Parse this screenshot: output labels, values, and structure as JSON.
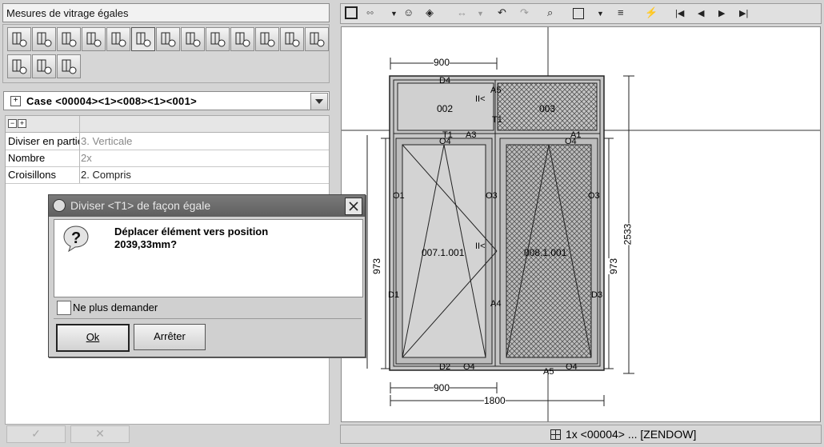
{
  "panel": {
    "title": "Mesures de vitrage égales",
    "combo_text": "Case <00004><1><008><1><001>",
    "props": [
      {
        "key": "Diviser en parties",
        "value": "3. Verticale",
        "dark": false
      },
      {
        "key": "Nombre",
        "value": "2x",
        "dark": false
      },
      {
        "key": "Croisillons",
        "value": "2. Compris",
        "dark": true
      }
    ],
    "ok_glyph": "✓",
    "cancel_glyph": "✕"
  },
  "toolbar": {
    "buttons": [
      "divide-sash-icon",
      "add-mullion-icon",
      "corner-icon",
      "remove-mullion-icon",
      "hand-measure-icon-1",
      "hand-measure-icon-2",
      "hand-measure-icon-3",
      "hand-measure-icon-4",
      "hand-measure-icon-5",
      "hand-measure-icon-6",
      "hand-measure-icon-7",
      "info-measure-icon",
      "info-measure-icon-2",
      "hand-measure-icon-8",
      "hand-measure-icon-9",
      "hand-measure-icon-10"
    ],
    "active_index": 5
  },
  "viewer": {
    "status": "1x <00004> ... [ZENDOW]"
  },
  "drawing": {
    "dim_top": "900",
    "dim_bottom_left": "900",
    "dim_bottom_total": "1800",
    "dim_right_total": "2533",
    "dim_right_lower": "973",
    "dim_left_lower": "973",
    "labels": {
      "top_left_pane": "002",
      "top_right_pane": "003",
      "left_sash": "007.1.001",
      "right_sash": "008.1.001",
      "a5_top": "A5",
      "a5_bottom": "A5",
      "a3": "A3",
      "a1": "A1",
      "a4": "A4",
      "d4": "D4",
      "d2": "D2",
      "d1": "D1",
      "d3": "D3",
      "o4_left": "O4",
      "o4_right": "O4",
      "o4_bl": "O4",
      "o4_br": "O4",
      "o1": "O1",
      "o3": "O3",
      "o3_mid": "O3",
      "t1_top": "T1",
      "t1_mid": "T1",
      "ii_top": "II<",
      "ii_mid": "II<"
    }
  },
  "dialog": {
    "title": "Diviser <T1> de façon égale",
    "message_line1": "Déplacer élément vers position",
    "message_line2": "2039,33mm?",
    "checkbox_label": "Ne plus demander",
    "ok_label": "Ok",
    "cancel_label": "Arrêter"
  }
}
